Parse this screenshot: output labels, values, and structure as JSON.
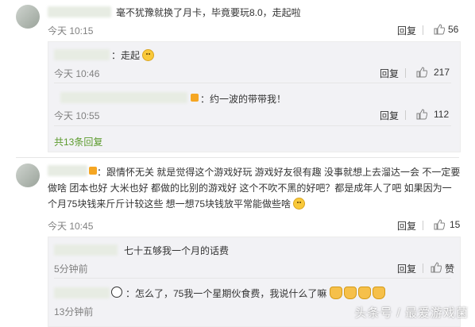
{
  "comments": [
    {
      "text": "毫不犹豫就换了月卡，毕竟要玩8.0，走起啦",
      "time": "今天 10:15",
      "reply_label": "回复",
      "likes": "56",
      "replies": [
        {
          "text": "：走起",
          "time": "今天 10:46",
          "reply_label": "回复",
          "likes": "217"
        },
        {
          "text": "：约一波的带带我！",
          "time": "今天 10:55",
          "reply_label": "回复",
          "likes": "112"
        }
      ],
      "more": "共13条回复"
    },
    {
      "text": "：跟情怀无关 就是觉得这个游戏好玩 游戏好友很有趣 没事就想上去溜达一会 不一定要做啥 团本也好 大米也好 都做的比别的游戏好 这个不吹不黑的好吧？都是成年人了吧 如果因为一个月75块钱来斤斤计较这些 想一想75块钱放平常能做些啥",
      "time": "今天 10:45",
      "reply_label": "回复",
      "likes": "15",
      "replies": [
        {
          "text": "七十五够我一个月的话费",
          "time": "5分钟前",
          "reply_label": "回复",
          "likes": "赞"
        },
        {
          "text": "：怎么了，75我一个星期伙食费，我说什么了嘛",
          "time": "13分钟前",
          "reply_label": "",
          "likes": ""
        }
      ]
    }
  ],
  "watermark": "头条号 / 最爱游戏菌",
  "colors": {
    "link_green": "#5b9a2c",
    "reply_bg": "#f2f2f5",
    "time_gray": "#808080"
  }
}
